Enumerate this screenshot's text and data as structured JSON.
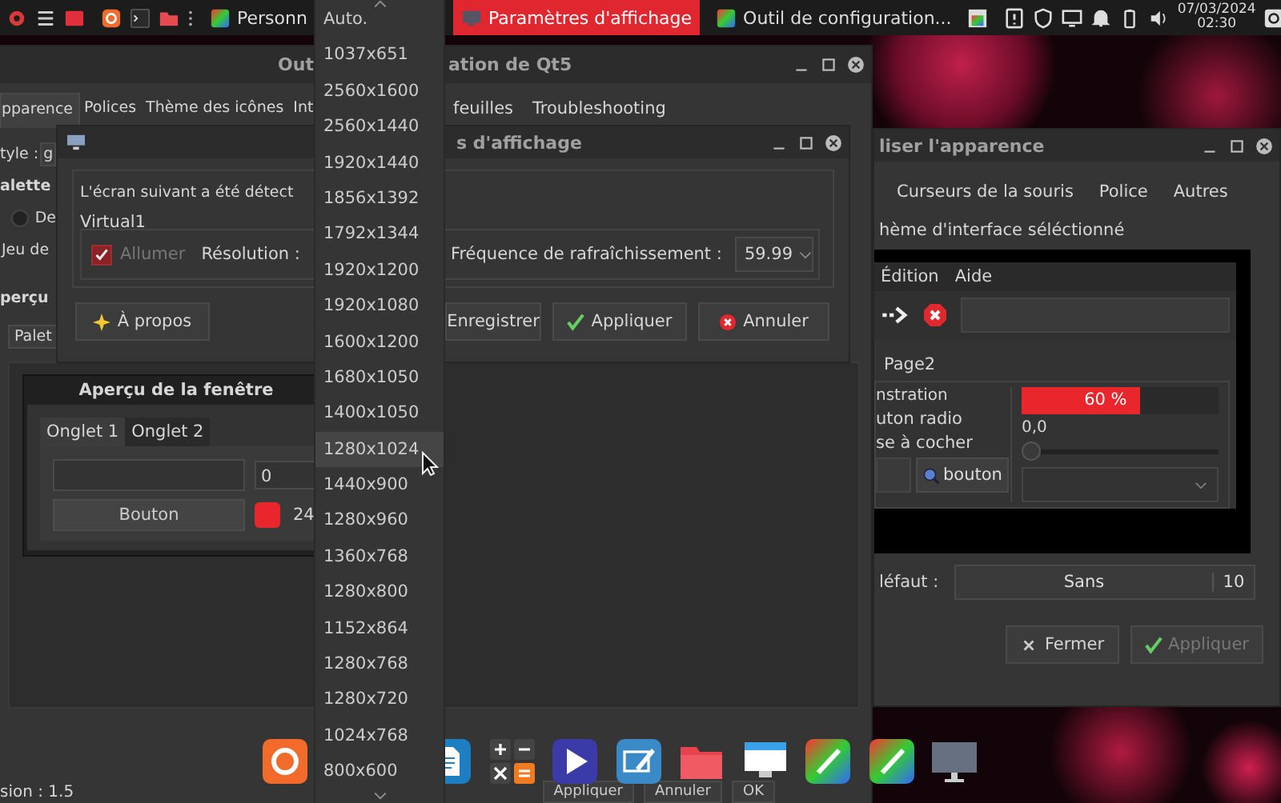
{
  "top_panel": {
    "tasks": [
      {
        "label": "Personn",
        "selected": false
      },
      {
        "label": "Paramètres d'affichage",
        "selected": true
      },
      {
        "label": "Outil de configuration...",
        "selected": false
      }
    ],
    "clock": {
      "date": "07/03/2024",
      "time": "02:30"
    }
  },
  "qt5_window": {
    "title_parts": [
      "Out",
      "ation de Qt5"
    ],
    "tabs": [
      {
        "label": "pparence",
        "selected": true
      },
      {
        "label": "Polices",
        "selected": false
      },
      {
        "label": "Thème des icônes",
        "selected": false
      },
      {
        "label": "Int",
        "selected": false
      },
      {
        "label": "feuilles",
        "selected": false
      },
      {
        "label": "Troubleshooting",
        "selected": false
      }
    ],
    "style_label": "tyle :",
    "style_value": "g",
    "palette_label": "alette",
    "palette_radio": {
      "label": "De",
      "selected": false
    },
    "icon_set_label": "Jeu de",
    "preview_label": "perçu",
    "preview_combo": "Palet",
    "preview_window": {
      "title": "Aperçu de la fenêtre",
      "tabs": [
        {
          "label": "Onglet 1",
          "selected": true
        },
        {
          "label": "Onglet 2",
          "selected": false
        }
      ],
      "spin_value": "0",
      "button": "Bouton",
      "percent": "24"
    },
    "version": "sion : 1.5",
    "buttons": [
      "Appliquer",
      "Annuler",
      "OK"
    ]
  },
  "display_dialog": {
    "title": "s d'affichage",
    "detected_text": "L'écran suivant a été détect",
    "screen_group": "Virtual1",
    "enable": {
      "label": "Allumer",
      "checked": true,
      "disabled": true
    },
    "resolution_label": "Résolution :",
    "refresh_label": "Fréquence de rafraîchissement :",
    "refresh_value": "59.99",
    "buttons": [
      {
        "label": "À propos",
        "kind": "about"
      },
      {
        "label": "Enregistrer",
        "kind": "save"
      },
      {
        "label": "Appliquer",
        "kind": "apply"
      },
      {
        "label": "Annuler",
        "kind": "cancel"
      }
    ]
  },
  "resolution_dropdown": {
    "items": [
      {
        "label": "Auto.",
        "selected": false
      },
      {
        "label": "1037x651",
        "selected": false
      },
      {
        "label": "2560x1600",
        "selected": false
      },
      {
        "label": "2560x1440",
        "selected": false
      },
      {
        "label": "1920x1440",
        "selected": false
      },
      {
        "label": "1856x1392",
        "selected": false
      },
      {
        "label": "1792x1344",
        "selected": false
      },
      {
        "label": "1920x1200",
        "selected": false
      },
      {
        "label": "1920x1080",
        "selected": false
      },
      {
        "label": "1600x1200",
        "selected": false
      },
      {
        "label": "1680x1050",
        "selected": false
      },
      {
        "label": "1400x1050",
        "selected": false
      },
      {
        "label": "1280x1024",
        "selected": true
      },
      {
        "label": "1440x900",
        "selected": false
      },
      {
        "label": "1280x960",
        "selected": false
      },
      {
        "label": "1360x768",
        "selected": false
      },
      {
        "label": "1280x800",
        "selected": false
      },
      {
        "label": "1152x864",
        "selected": false
      },
      {
        "label": "1280x768",
        "selected": false
      },
      {
        "label": "1280x720",
        "selected": false
      },
      {
        "label": "1024x768",
        "selected": false
      },
      {
        "label": "800x600",
        "selected": false
      }
    ]
  },
  "appearance_window": {
    "title": "liser l'apparence",
    "tabs": [
      {
        "label": "Curseurs de la souris",
        "selected": false
      },
      {
        "label": "Police",
        "selected": false
      },
      {
        "label": "Autres",
        "selected": false
      }
    ],
    "theme_label": "hème d'interface séléctionné",
    "preview": {
      "menu": [
        "Édition",
        "Aide"
      ],
      "tab": "Page2",
      "group_title": "nstration",
      "radio_label": "uton radio",
      "checkbox_label": "se à cocher",
      "button": "bouton",
      "progress": {
        "level": 0.6,
        "reading": "60 %"
      },
      "slider_reading": "0,0",
      "slider": {
        "level": 0
      }
    },
    "default_font_label": "léfaut :",
    "font_name": "Sans",
    "font_size": "10",
    "buttons": [
      {
        "label": "Fermer",
        "kind": "close",
        "disabled": false
      },
      {
        "label": "Appliquer",
        "kind": "apply",
        "disabled": true
      }
    ]
  }
}
